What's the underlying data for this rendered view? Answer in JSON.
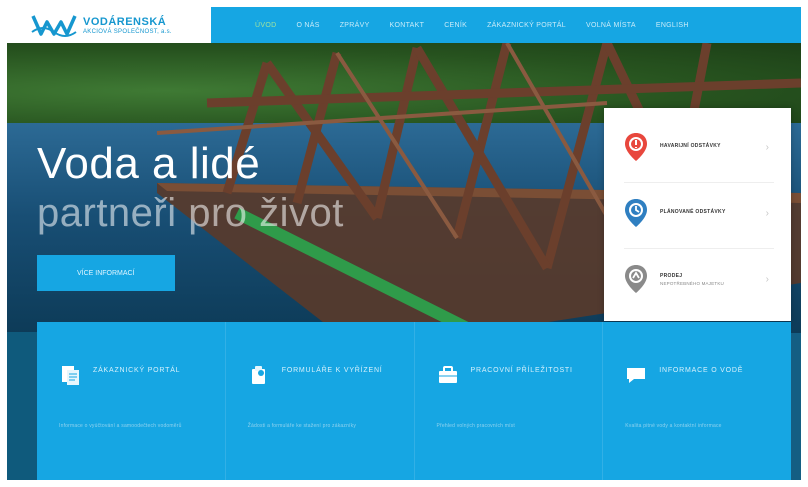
{
  "brand": {
    "name": "VODÁRENSKÁ",
    "subtitle": "AKCIOVÁ SPOLEČNOST, a.s."
  },
  "nav": {
    "items": [
      "ÚVOD",
      "O NÁS",
      "ZPRÁVY",
      "KONTAKT",
      "CENÍK",
      "ZÁKAZNICKÝ PORTÁL",
      "VOLNÁ MÍSTA",
      "ENGLISH"
    ]
  },
  "hero": {
    "title": "Voda a lidé",
    "subtitle": "partneři pro život",
    "button": "VÍCE INFORMACÍ"
  },
  "card": {
    "items": [
      {
        "label": "HAVARIJNÍ ODSTÁVKY",
        "sub": ""
      },
      {
        "label": "PLÁNOVANÉ ODSTÁVKY",
        "sub": ""
      },
      {
        "label": "PRODEJ",
        "sub": "NEPOTŘEBNÉHO MAJETKU"
      }
    ]
  },
  "panel": {
    "columns": [
      {
        "title": "ZÁKAZNICKÝ PORTÁL",
        "desc": "Informace o vyúčtování a samoodečtech vodoměrů"
      },
      {
        "title": "FORMULÁŘE K VYŘÍZENÍ",
        "desc": "Žádosti a formuláře ke stažení pro zákazníky"
      },
      {
        "title": "PRACOVNÍ PŘÍLEŽITOSTI",
        "desc": "Přehled volných pracovních míst"
      },
      {
        "title": "INFORMACE O VODĚ",
        "desc": "Kvalita pitné vody a kontaktní informace"
      }
    ]
  },
  "colors": {
    "accent": "#16a6e3",
    "header": "#16a6e3",
    "pin_red": "#e8473d",
    "pin_blue": "#2f7fc1",
    "pin_gray": "#8a8a8a"
  },
  "icons": {
    "card": [
      "location-pin-icon",
      "location-pin-icon",
      "location-pin-icon"
    ],
    "panel": [
      "document-icon",
      "form-icon",
      "briefcase-icon",
      "chat-icon"
    ]
  }
}
